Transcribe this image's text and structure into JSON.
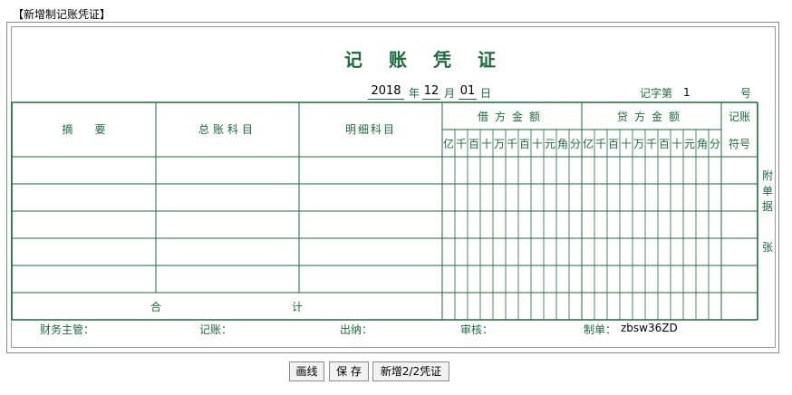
{
  "page": {
    "title": "【新增制记账凭证】"
  },
  "voucher": {
    "title": "记账凭证",
    "date": {
      "year": "2018",
      "year_unit": "年",
      "month": "12",
      "month_unit": "月",
      "day": "01",
      "day_unit": "日"
    },
    "number_label": "记字第",
    "number_value": "1",
    "number_suffix": "号",
    "table": {
      "col_summary": "摘　　要",
      "col_account": "总账科目",
      "col_detail": "明细科目",
      "col_debit": "借方金额",
      "col_credit": "贷方金额",
      "col_mark_top": "记账",
      "col_mark_bottom": "符号",
      "digit_units": [
        "亿",
        "千",
        "百",
        "十",
        "万",
        "千",
        "百",
        "十",
        "元",
        "角",
        "分"
      ],
      "total_label_1": "合",
      "total_label_2": "计",
      "rows": 5
    },
    "side_note_1": "附单据",
    "side_note_2": "张",
    "signatures": {
      "manager": "财务主管：",
      "bookkeeper": "记账：",
      "cashier": "出纳：",
      "auditor": "审核：",
      "maker": "制单：",
      "maker_value": "zbsw36ZD"
    }
  },
  "buttons": {
    "draw_line": "画线",
    "save": "保 存",
    "new_voucher": "新增2/2凭证"
  },
  "colors": {
    "accent": "#1a6b3a",
    "grid": "#1a6b3a"
  }
}
